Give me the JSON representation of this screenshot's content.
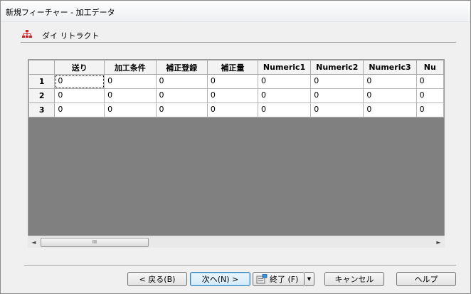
{
  "window": {
    "title": "新規フィーチャー - 加工データ"
  },
  "section": {
    "label": "ダイ リトラクト",
    "icon": "hierarchy-icon",
    "icon_color": "#d02020"
  },
  "grid": {
    "columns": [
      "送り",
      "加工条件",
      "補正登録",
      "補正量",
      "Numeric1",
      "Numeric2",
      "Numeric3",
      "Nu"
    ],
    "rows": [
      {
        "label": "1",
        "cells": [
          "0",
          "0",
          "0",
          "0",
          "0",
          "0",
          "0",
          "0"
        ]
      },
      {
        "label": "2",
        "cells": [
          "0",
          "0",
          "0",
          "0",
          "0",
          "0",
          "0",
          "0"
        ]
      },
      {
        "label": "3",
        "cells": [
          "0",
          "0",
          "0",
          "0",
          "0",
          "0",
          "0",
          "0"
        ]
      }
    ],
    "empty_area_color": "#808080"
  },
  "scrollbar": {
    "left_arrow": "◄",
    "right_arrow": "►",
    "thumb_grip": "III"
  },
  "buttons": {
    "back": "< 戻る(B)",
    "next": "次へ(N) >",
    "finish": "終了 (F)",
    "finish_dropdown": "▼",
    "cancel": "キャンセル",
    "help": "ヘルプ"
  }
}
